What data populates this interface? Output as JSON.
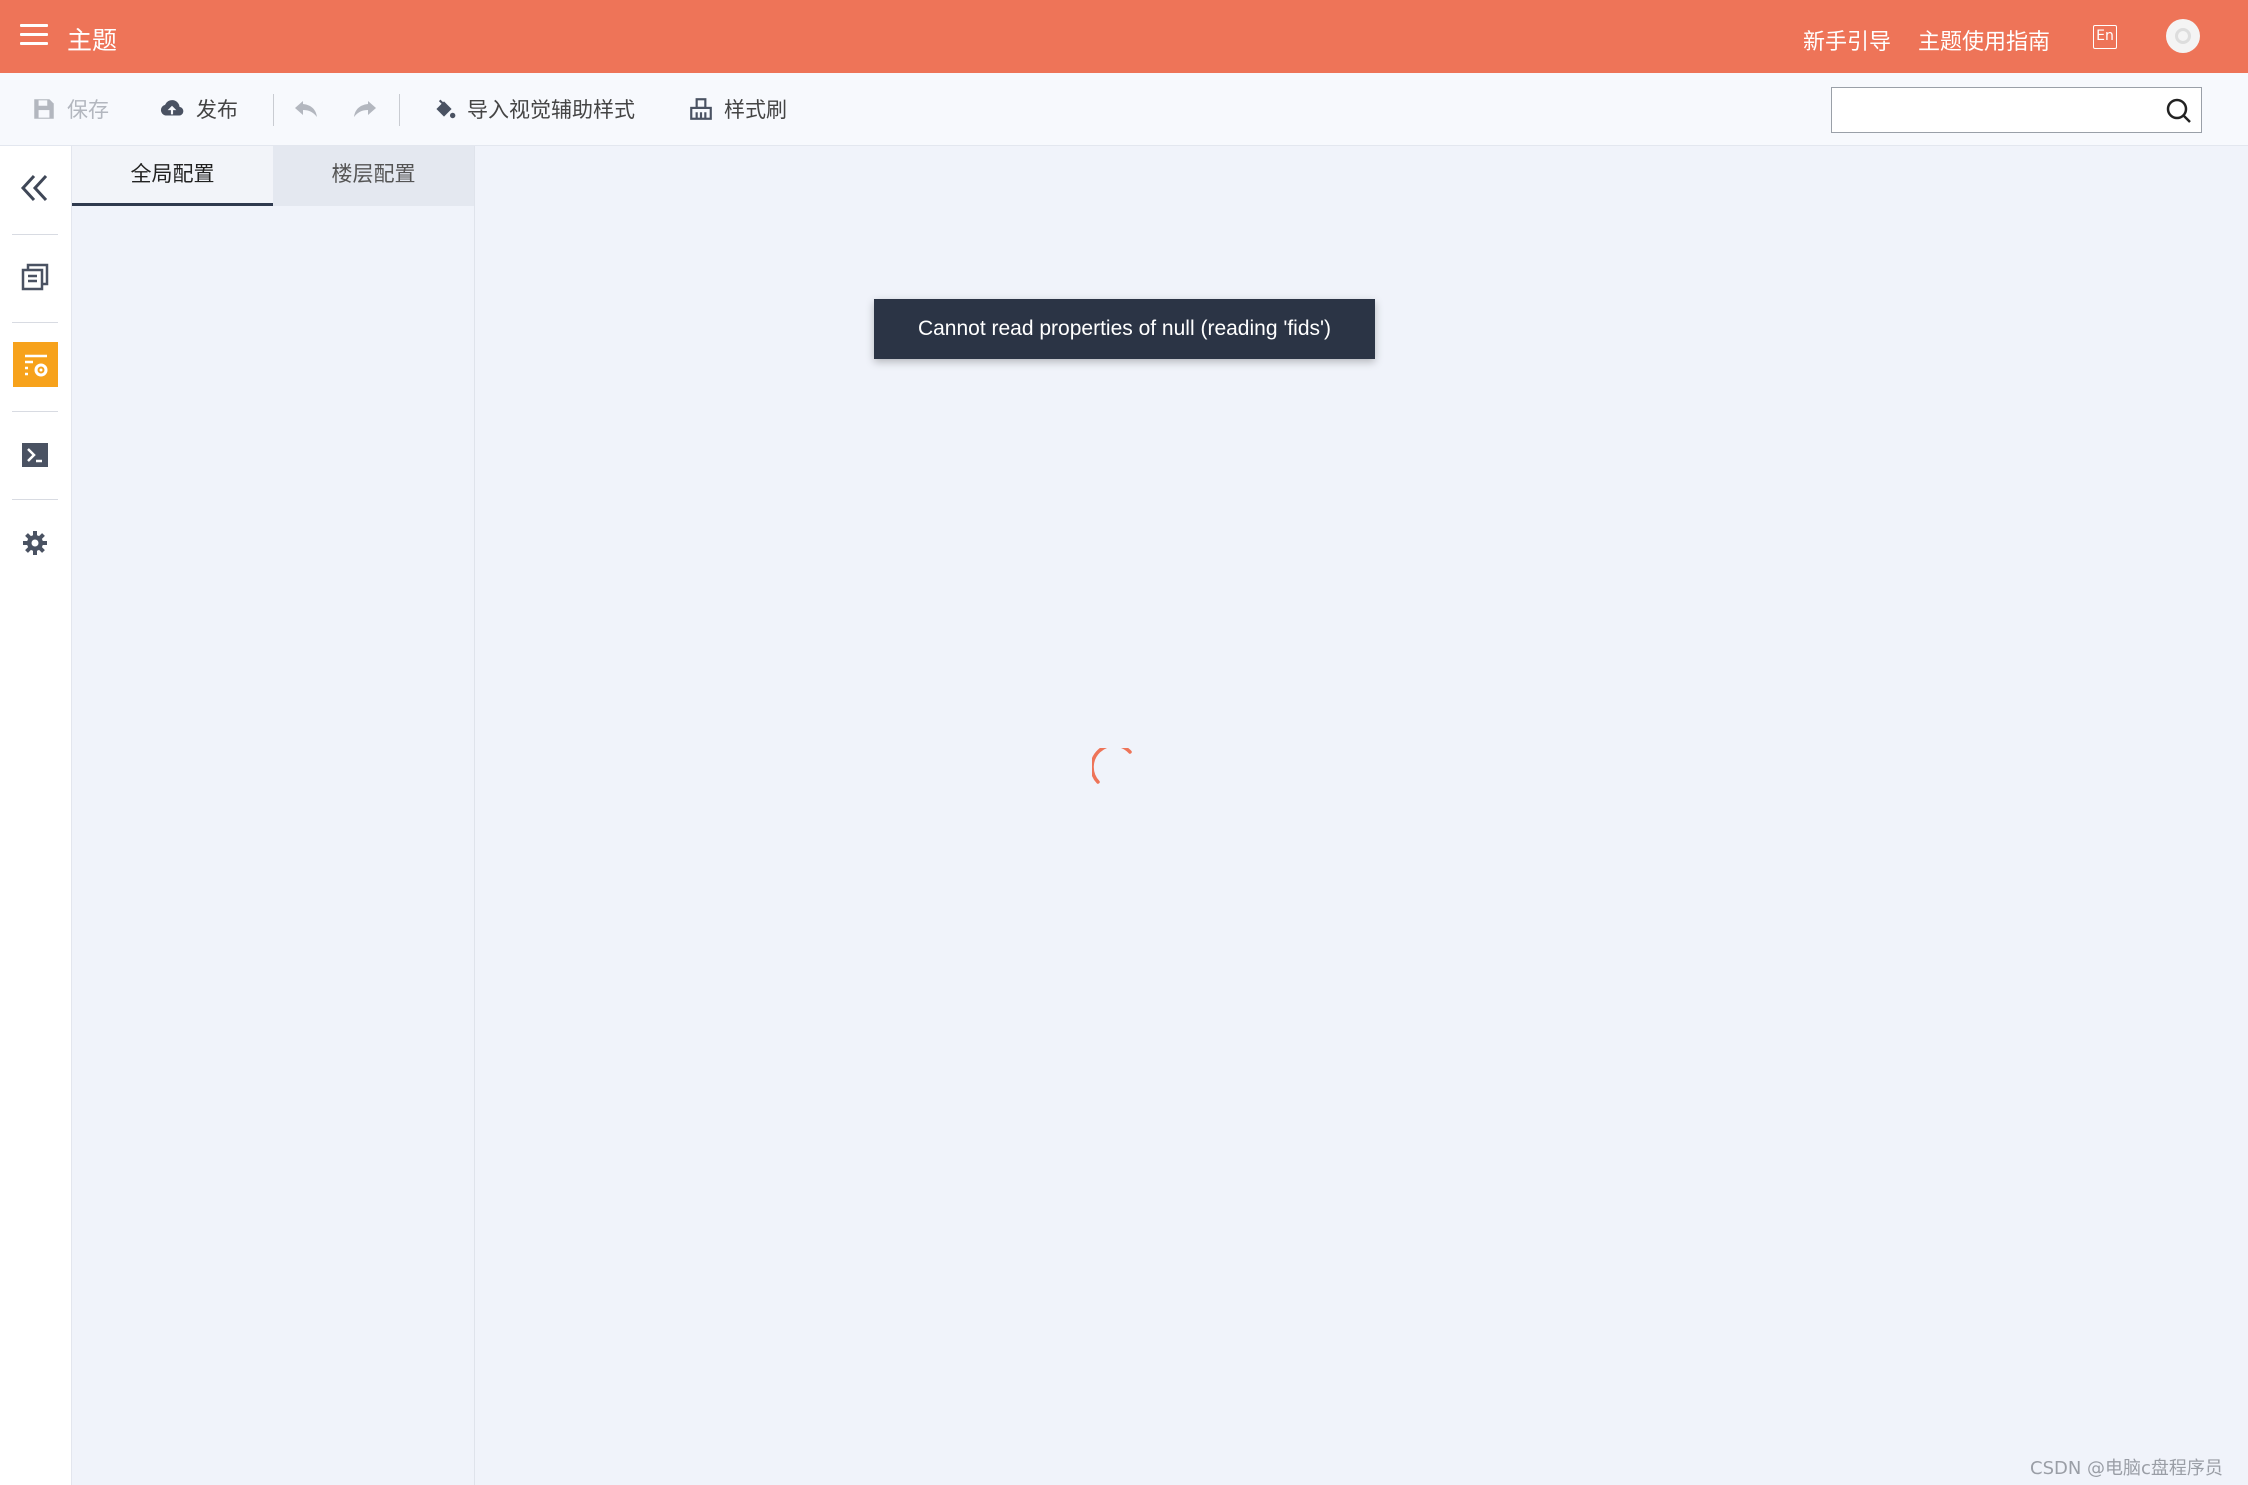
{
  "header": {
    "title": "主题",
    "links": [
      "新手引导",
      "主题使用指南"
    ],
    "lang_label": "En"
  },
  "toolbar": {
    "save_label": "保存",
    "publish_label": "发布",
    "import_label": "导入视觉辅助样式",
    "brush_label": "样式刷",
    "search_placeholder": ""
  },
  "panel": {
    "tabs": [
      {
        "label": "全局配置",
        "active": true
      },
      {
        "label": "楼层配置",
        "active": false
      }
    ]
  },
  "rail": {
    "items": [
      "collapse-icon",
      "pages-icon",
      "theme-config-icon",
      "terminal-icon",
      "gear-icon"
    ],
    "active": "theme-config-icon"
  },
  "toast": {
    "message": "Cannot read properties of null (reading 'fids')"
  },
  "colors": {
    "brand": "#ee7458",
    "active_rail": "#f7a21b",
    "toast_bg": "#2b3445"
  },
  "watermark": "CSDN @电脑c盘程序员"
}
